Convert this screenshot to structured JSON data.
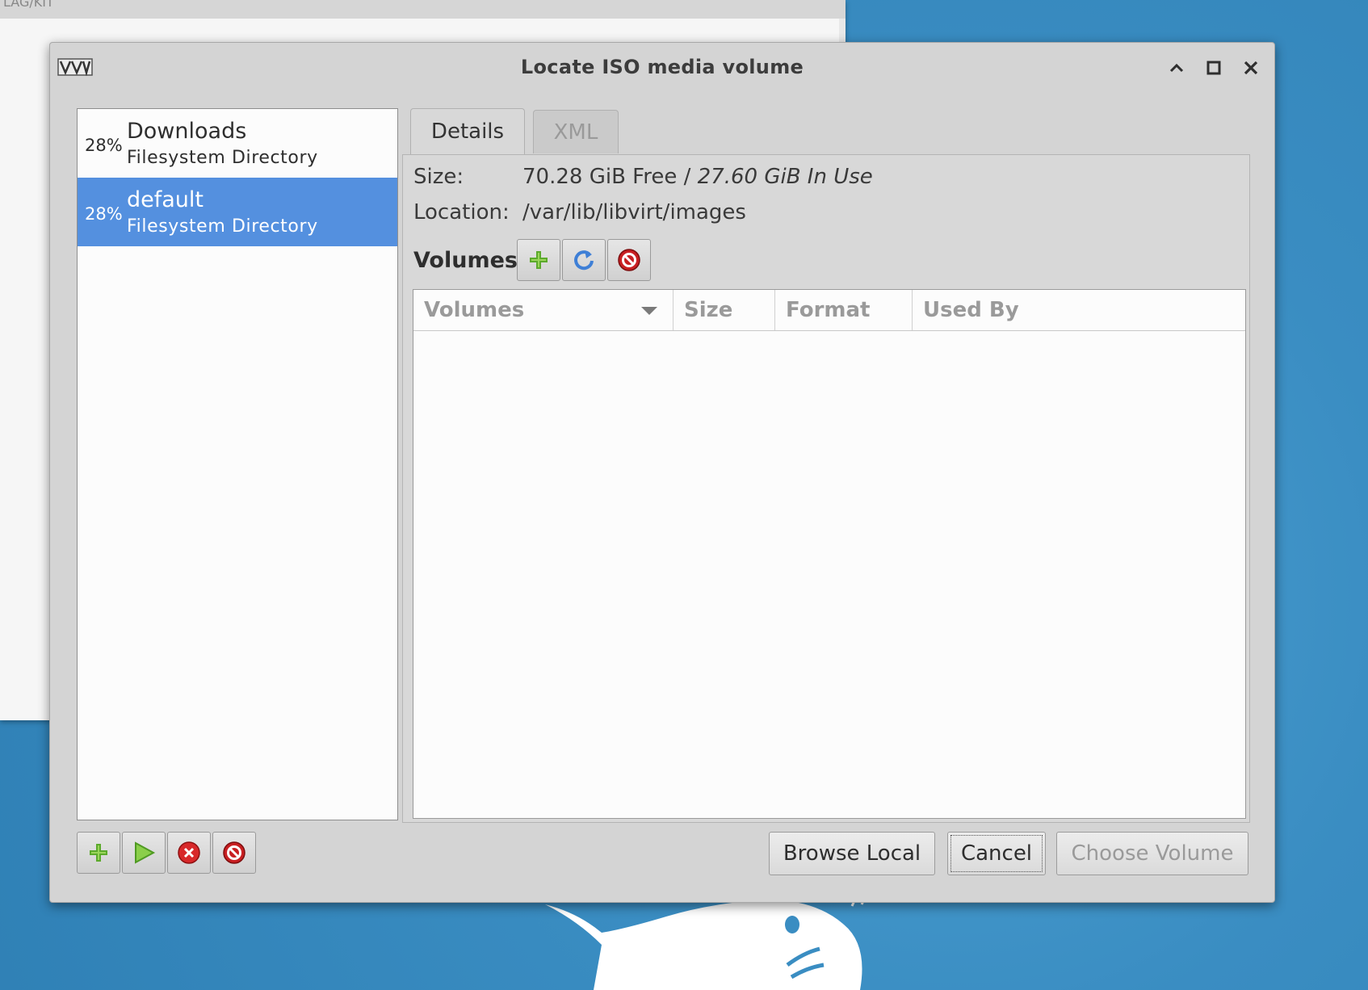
{
  "background_window": {
    "title_fragment": "LAG/KIT"
  },
  "dialog": {
    "title": "Locate ISO media volume",
    "app_icon": "virt-manager-icon"
  },
  "window_controls": [
    "minimize-icon",
    "maximize-icon",
    "close-icon"
  ],
  "pools": [
    {
      "percent": "28%",
      "name": "Downloads",
      "type": "Filesystem Directory",
      "selected": false
    },
    {
      "percent": "28%",
      "name": "default",
      "type": "Filesystem Directory",
      "selected": true
    }
  ],
  "pool_toolbar": [
    "add-pool-icon",
    "start-pool-icon",
    "stop-pool-icon",
    "delete-pool-icon"
  ],
  "tabs": [
    {
      "label": "Details",
      "active": true
    },
    {
      "label": "XML",
      "active": false
    }
  ],
  "details": {
    "size_label": "Size:",
    "size_free": "70.28 GiB Free /",
    "size_inuse": "27.60 GiB In Use",
    "location_label": "Location:",
    "location_value": "/var/lib/libvirt/images",
    "volumes_label": "Volumes"
  },
  "volume_toolbar": [
    "add-volume-icon",
    "refresh-icon",
    "delete-volume-icon"
  ],
  "volume_columns": [
    "Volumes",
    "Size",
    "Format",
    "Used By"
  ],
  "volumes": [],
  "buttons": {
    "browse_local": "Browse Local",
    "cancel": "Cancel",
    "choose_volume": "Choose Volume"
  },
  "colors": {
    "selection": "#5490df",
    "desktop": "#3a8dc2",
    "dialog_bg": "#d4d4d4"
  }
}
